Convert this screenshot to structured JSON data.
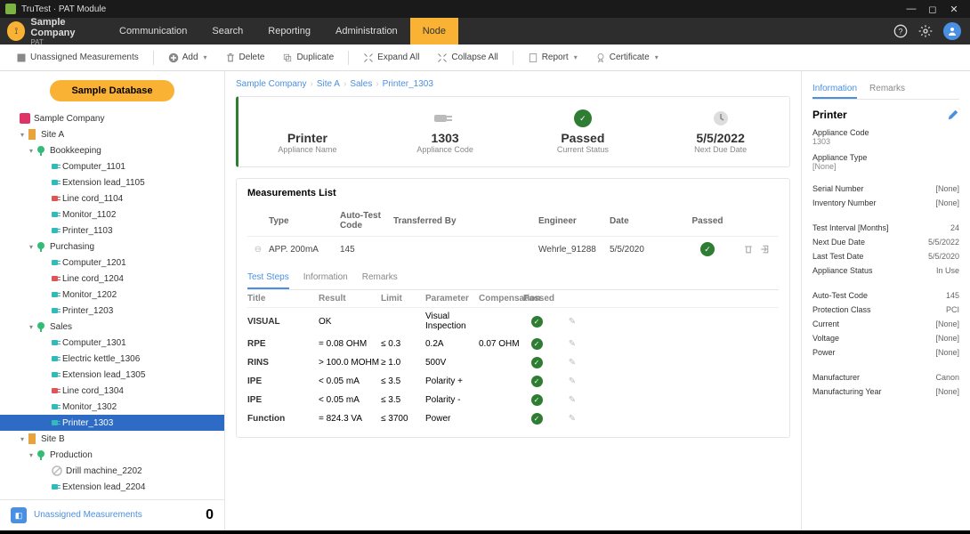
{
  "window": {
    "title": "TruTest · PAT Module"
  },
  "brand": {
    "name": "Sample Company",
    "sub": "PAT"
  },
  "nav": [
    "Communication",
    "Search",
    "Reporting",
    "Administration",
    "Node"
  ],
  "nav_active": 4,
  "toolbar": {
    "unassigned": "Unassigned Measurements",
    "add": "Add",
    "delete": "Delete",
    "duplicate": "Duplicate",
    "expand": "Expand All",
    "collapse": "Collapse All",
    "report": "Report",
    "certificate": "Certificate"
  },
  "sample_btn": "Sample Database",
  "tree": {
    "root": "Sample Company",
    "site_a": "Site A",
    "groups": {
      "bookkeeping": {
        "label": "Bookkeeping",
        "items": [
          "Computer_1101",
          "Extension lead_1105",
          "Line cord_1104",
          "Monitor_1102",
          "Printer_1103"
        ]
      },
      "purchasing": {
        "label": "Purchasing",
        "items": [
          "Computer_1201",
          "Line cord_1204",
          "Monitor_1202",
          "Printer_1203"
        ]
      },
      "sales": {
        "label": "Sales",
        "items": [
          "Computer_1301",
          "Electric kettle_1306",
          "Extension lead_1305",
          "Line cord_1304",
          "Monitor_1302",
          "Printer_1303"
        ]
      }
    },
    "site_b": "Site B",
    "production": {
      "label": "Production",
      "items": [
        "Drill machine_2202",
        "Extension lead_2204"
      ]
    },
    "selected": "Printer_1303"
  },
  "unassigned_footer": {
    "label": "Unassigned Measurements",
    "count": "0"
  },
  "breadcrumb": [
    "Sample Company",
    "Site A",
    "Sales",
    "Printer_1303"
  ],
  "summary": {
    "name": {
      "val": "Printer",
      "lab": "Appliance Name"
    },
    "code": {
      "val": "1303",
      "lab": "Appliance Code"
    },
    "status": {
      "val": "Passed",
      "lab": "Current Status"
    },
    "due": {
      "val": "5/5/2022",
      "lab": "Next Due Date"
    }
  },
  "mlist": {
    "title": "Measurements List",
    "headers": {
      "type": "Type",
      "code": "Auto-Test Code",
      "trans": "Transferred By",
      "eng": "Engineer",
      "date": "Date",
      "pass": "Passed"
    },
    "row": {
      "type": "APP. 200mA",
      "code": "145",
      "eng": "Wehrle_91288",
      "date": "5/5/2020"
    },
    "subtabs": [
      "Test Steps",
      "Information",
      "Remarks"
    ],
    "subtab_active": 0,
    "step_headers": {
      "title": "Title",
      "result": "Result",
      "limit": "Limit",
      "param": "Parameter",
      "comp": "Compensation",
      "pass": "Passed"
    },
    "steps": [
      {
        "title": "VISUAL",
        "result": "OK",
        "limit": "",
        "param": "Visual Inspection",
        "comp": ""
      },
      {
        "title": "RPE",
        "result": "= 0.08 OHM",
        "limit": "≤ 0.3",
        "param": "0.2A",
        "comp": "0.07 OHM"
      },
      {
        "title": "RINS",
        "result": "> 100.0 MOHM",
        "limit": "≥ 1.0",
        "param": "500V",
        "comp": ""
      },
      {
        "title": "IPE",
        "result": "< 0.05 mA",
        "limit": "≤ 3.5",
        "param": "Polarity +",
        "comp": ""
      },
      {
        "title": "IPE",
        "result": "< 0.05 mA",
        "limit": "≤ 3.5",
        "param": "Polarity -",
        "comp": ""
      },
      {
        "title": "Function",
        "result": "= 824.3 VA",
        "limit": "≤ 3700",
        "param": "Power",
        "comp": ""
      }
    ]
  },
  "rpanel": {
    "tabs": [
      "Information",
      "Remarks"
    ],
    "title": "Printer",
    "f1": {
      "lab": "Appliance Code",
      "val": "1303"
    },
    "f2": {
      "lab": "Appliance Type",
      "val": "[None]"
    },
    "rows1": [
      {
        "l": "Serial Number",
        "v": "[None]"
      },
      {
        "l": "Inventory Number",
        "v": "[None]"
      }
    ],
    "rows2": [
      {
        "l": "Test Interval [Months]",
        "v": "24"
      },
      {
        "l": "Next Due Date",
        "v": "5/5/2022"
      },
      {
        "l": "Last Test Date",
        "v": "5/5/2020"
      },
      {
        "l": "Appliance Status",
        "v": "In Use"
      }
    ],
    "rows3": [
      {
        "l": "Auto-Test Code",
        "v": "145"
      },
      {
        "l": "Protection Class",
        "v": "PCI"
      },
      {
        "l": "Current",
        "v": "[None]"
      },
      {
        "l": "Voltage",
        "v": "[None]"
      },
      {
        "l": "Power",
        "v": "[None]"
      }
    ],
    "rows4": [
      {
        "l": "Manufacturer",
        "v": "Canon"
      },
      {
        "l": "Manufacturing Year",
        "v": "[None]"
      }
    ]
  }
}
